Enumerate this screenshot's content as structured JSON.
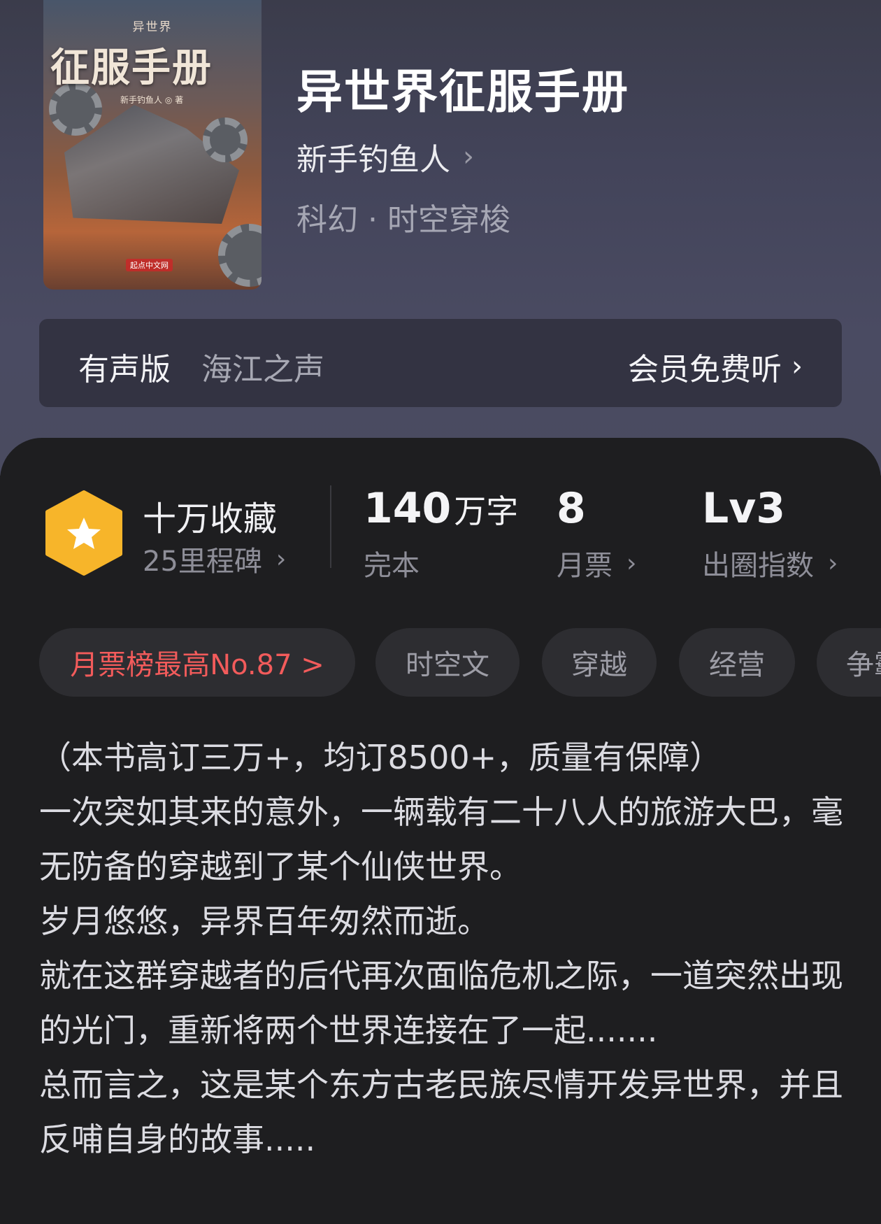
{
  "book": {
    "title": "异世界征服手册",
    "author": "新手钓鱼人",
    "genre": "科幻 · 时空穿梭",
    "cover": {
      "series": "异世界",
      "title": "征服手册",
      "author_line": "新手钓鱼人 ◎ 著",
      "publisher": "起点中文网"
    }
  },
  "audio": {
    "label": "有声版",
    "narrator": "海江之声",
    "cta": "会员免费听"
  },
  "stats": {
    "collect_title": "十万收藏",
    "collect_sub": "25里程碑",
    "words_value": "140",
    "words_unit": "万字",
    "words_label": "完本",
    "monthly_value": "8",
    "monthly_label": "月票",
    "level_value": "Lv3",
    "level_label": "出圈指数"
  },
  "tags": [
    "月票榜最高No.87 >",
    "时空文",
    "穿越",
    "经营",
    "争霸"
  ],
  "description": [
    "（本书高订三万+，均订8500+，质量有保障）",
    "一次突如其来的意外，一辆载有二十八人的旅游大巴，毫无防备的穿越到了某个仙侠世界。",
    "岁月悠悠，异界百年匆然而逝。",
    "就在这群穿越者的后代再次面临危机之际，一道突然出现的光门，重新将两个世界连接在了一起.......",
    "总而言之，这是某个东方古老民族尽情开发异世界，并且反哺自身的故事....."
  ],
  "colors": {
    "accent_red": "#f25b5b",
    "badge_yellow": "#f7b52a",
    "background": "#1e1e20"
  },
  "icons": {
    "chevron": "chevron-right-icon",
    "badge": "star-hexagon-icon"
  }
}
